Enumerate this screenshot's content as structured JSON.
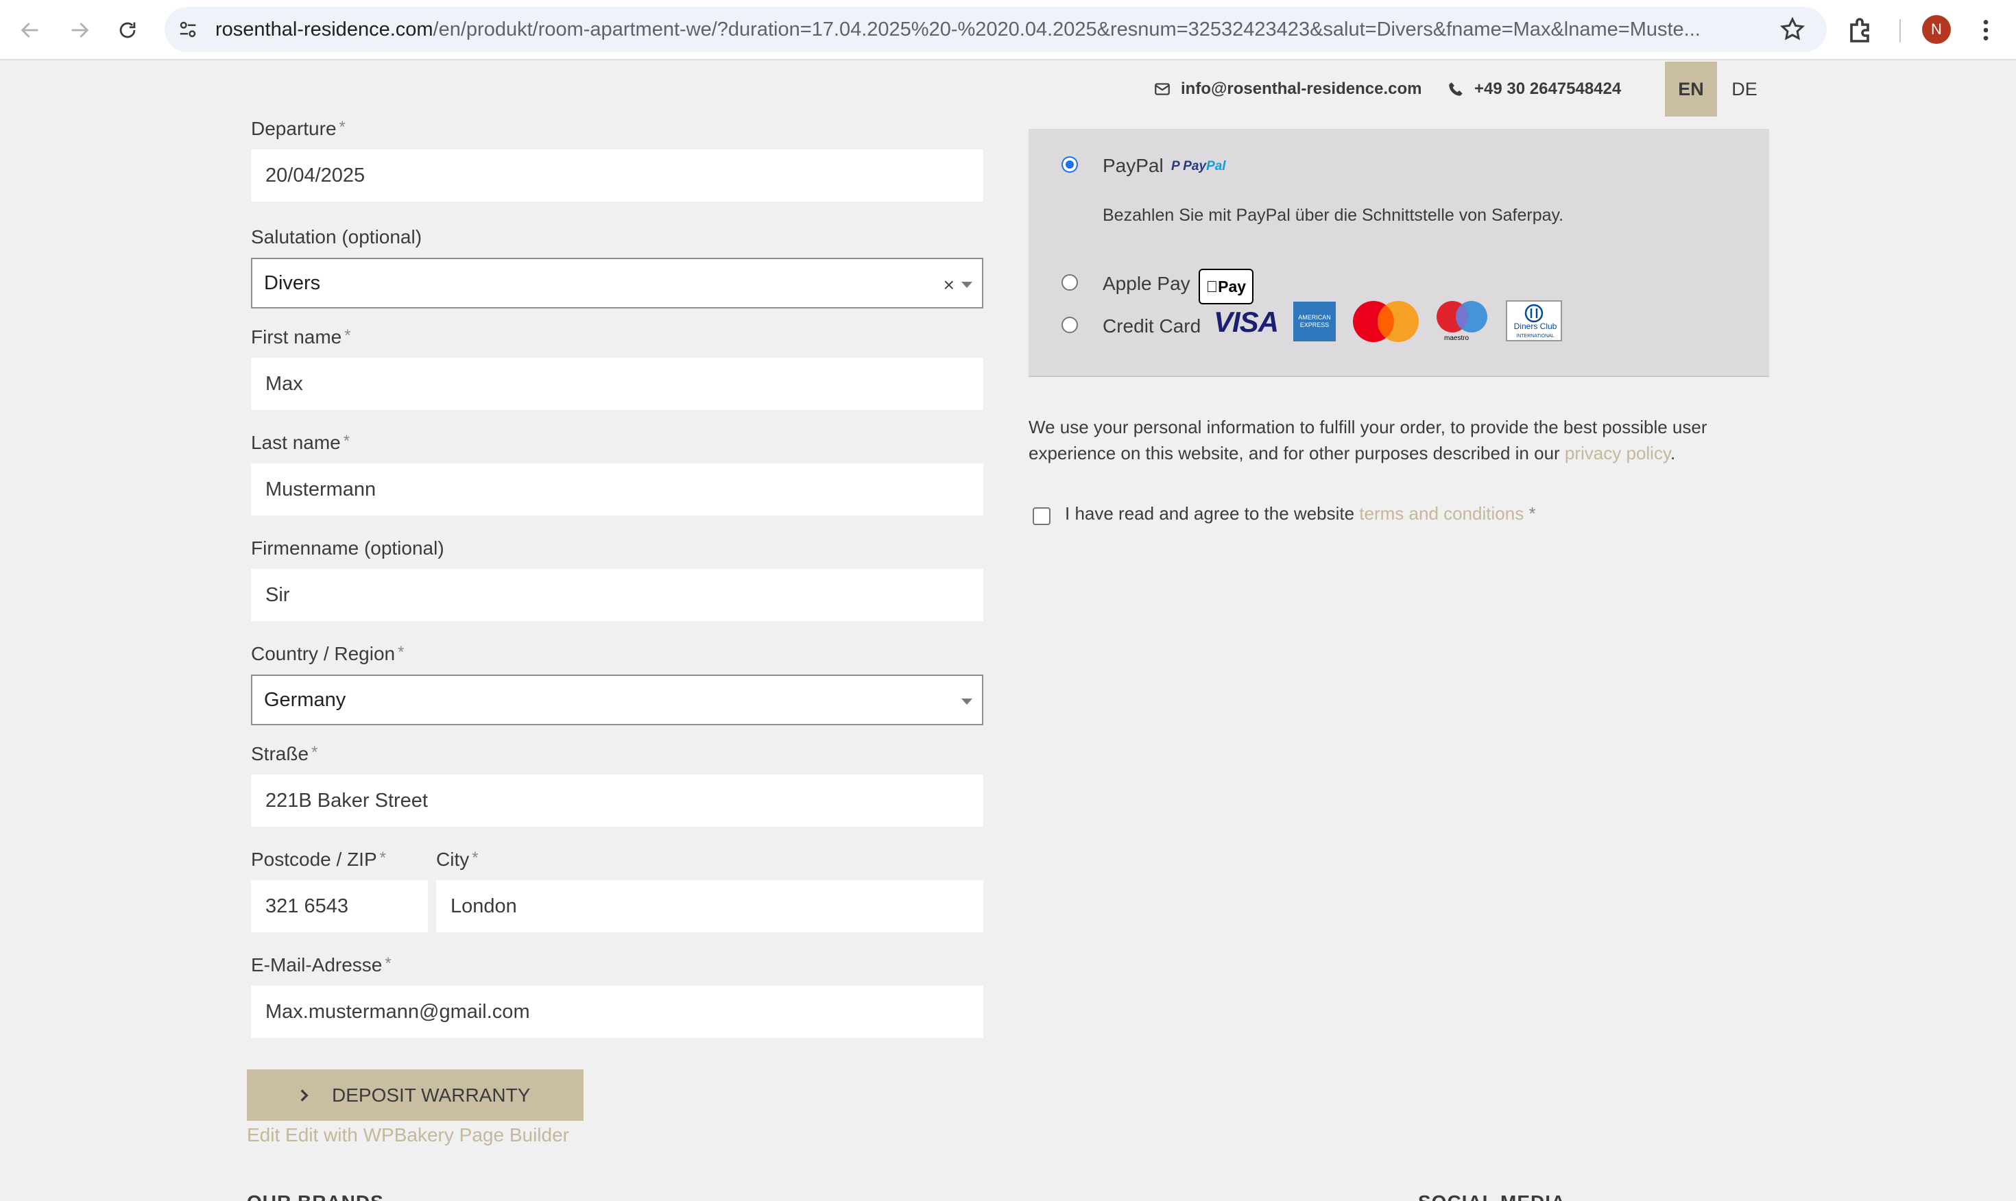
{
  "browser": {
    "url_host": "rosenthal-residence.com",
    "url_rest": "/en/produkt/room-apartment-we/?duration=17.04.2025%20-%2020.04.2025&resnum=32532423423&salut=Divers&fname=Max&lname=Muste...",
    "profile_initial": "N"
  },
  "topbar": {
    "email": "info@rosenthal-residence.com",
    "phone": "+49 30 2647548424",
    "lang_en": "EN",
    "lang_de": "DE"
  },
  "form": {
    "departure_label": "Departure",
    "departure_value": "20/04/2025",
    "salutation_label": "Salutation (optional)",
    "salutation_value": "Divers",
    "salutation_clear": "×",
    "firstname_label": "First name",
    "firstname_value": "Max",
    "lastname_label": "Last name",
    "lastname_value": "Mustermann",
    "company_label": "Firmenname (optional)",
    "company_value": "Sir",
    "country_label": "Country / Region",
    "country_value": "Germany",
    "street_label": "Straße",
    "street_value": "221B Baker Street",
    "postcode_label": "Postcode / ZIP",
    "postcode_value": "321 6543",
    "city_label": "City",
    "city_value": "London",
    "email_label": "E-Mail-Adresse",
    "email_value": "Max.mustermann@gmail.com",
    "required_mark": "*",
    "submit_label": "DEPOSIT WARRANTY",
    "edit_link": "Edit Edit with WPBakery Page Builder"
  },
  "payment": {
    "paypal_label": "PayPal",
    "paypal_logo_a": "Pay",
    "paypal_logo_b": "Pal",
    "paypal_desc": "Bezahlen Sie mit PayPal über die Schnittstelle von Saferpay.",
    "applepay_label": "Apple Pay",
    "applepay_badge": "Pay",
    "creditcard_label": "Credit Card",
    "visa": "VISA",
    "amex_a": "AMERICAN",
    "amex_b": "EXPRESS",
    "maestro": "maestro",
    "diners_a": "Diners Club",
    "diners_b": "INTERNATIONAL",
    "selected": "paypal"
  },
  "legal": {
    "privacy_text": "We use your personal information to fulfill your order, to provide the best possible user experience on this website, and for other purposes described in our ",
    "privacy_link": "privacy policy",
    "privacy_end": ".",
    "terms_text": "I have read and agree to the website ",
    "terms_link": "terms and conditions",
    "terms_req": "*"
  },
  "footer": {
    "left_heading": "OUR BRANDS",
    "right_heading": "SOCIAL MEDIA"
  }
}
